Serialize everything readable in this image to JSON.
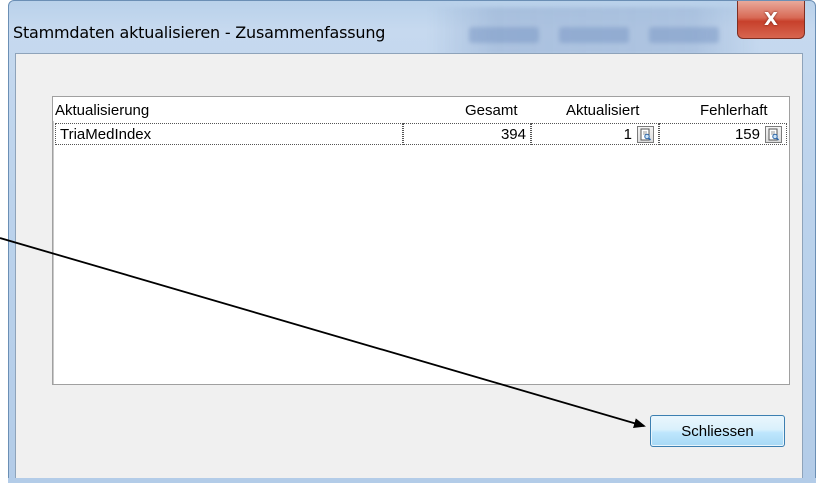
{
  "window": {
    "title": "Stammdaten aktualisieren - Zusammenfassung",
    "close_glyph": "X"
  },
  "table": {
    "columns": [
      "Aktualisierung",
      "Gesamt",
      "Aktualisiert",
      "Fehlerhaft"
    ],
    "rows": [
      {
        "name": "TriaMedIndex",
        "gesamt": "394",
        "aktualisiert": "1",
        "fehlerhaft": "159"
      }
    ]
  },
  "buttons": {
    "close_label": "Schliessen"
  },
  "colors": {
    "close_button_red": "#c7402b",
    "accent_button_border": "#3c7fb1"
  },
  "icons": [
    "close-icon",
    "document-preview-icon",
    "annotation-arrow"
  ]
}
